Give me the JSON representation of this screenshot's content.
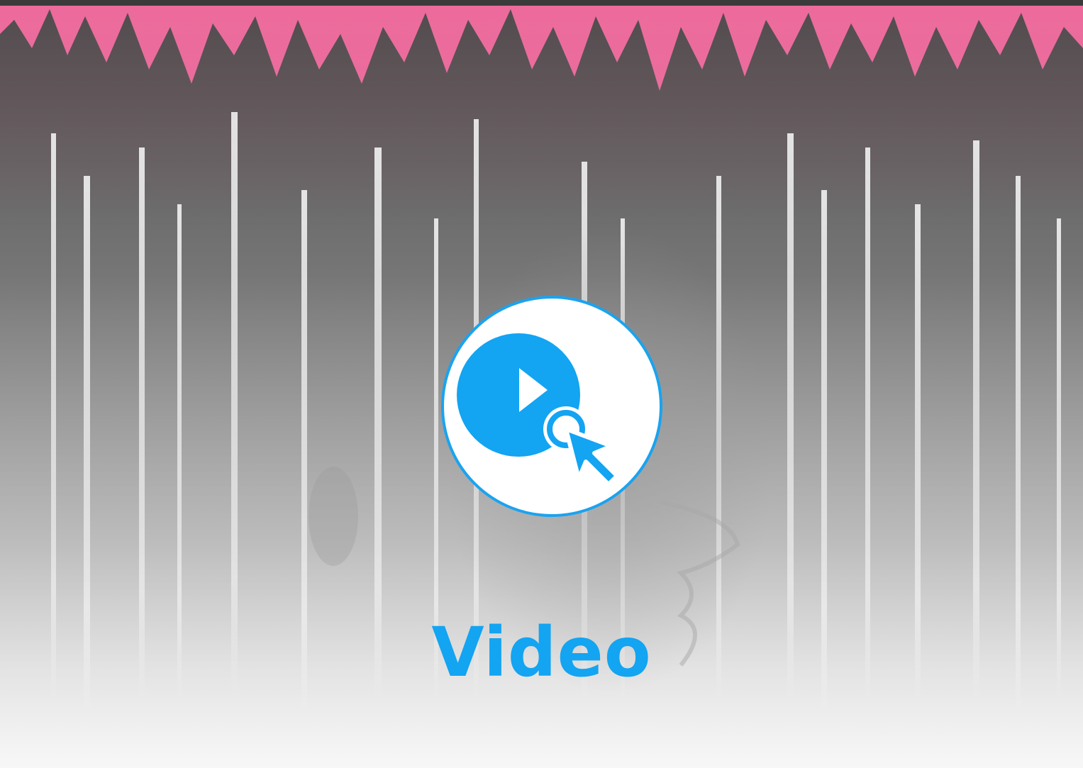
{
  "video_tile": {
    "label": "Video",
    "icon": "play-cursor-icon",
    "accent_color": "#13a4f2",
    "sky_color": "#ec6b9c"
  }
}
